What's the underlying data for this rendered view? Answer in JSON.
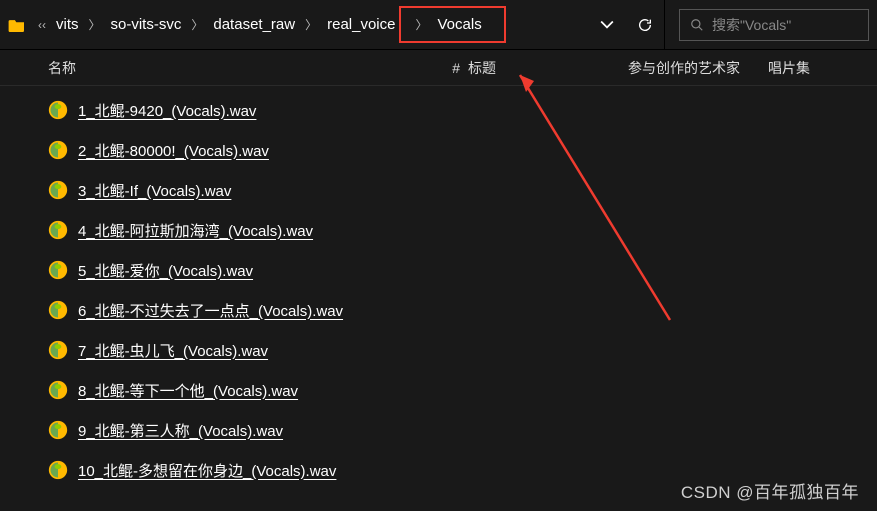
{
  "breadcrumbs": {
    "items": [
      "vits",
      "so-vits-svc",
      "dataset_raw",
      "real_voice",
      "Vocals"
    ]
  },
  "search": {
    "placeholder": "搜索\"Vocals\""
  },
  "columns": {
    "name": "名称",
    "num": "#",
    "title": "标题",
    "artist": "参与创作的艺术家",
    "album": "唱片集"
  },
  "files": [
    {
      "name": "1_北鲲-9420_(Vocals).wav"
    },
    {
      "name": "2_北鲲-80000!_(Vocals).wav"
    },
    {
      "name": "3_北鲲-If_(Vocals).wav"
    },
    {
      "name": "4_北鲲-阿拉斯加海湾_(Vocals).wav"
    },
    {
      "name": "5_北鲲-爱你_(Vocals).wav"
    },
    {
      "name": "6_北鲲-不过失去了一点点_(Vocals).wav"
    },
    {
      "name": "7_北鲲-虫儿飞_(Vocals).wav"
    },
    {
      "name": "8_北鲲-等下一个他_(Vocals).wav"
    },
    {
      "name": "9_北鲲-第三人称_(Vocals).wav"
    },
    {
      "name": "10_北鲲-多想留在你身边_(Vocals).wav"
    }
  ],
  "watermark": "CSDN @百年孤独百年"
}
